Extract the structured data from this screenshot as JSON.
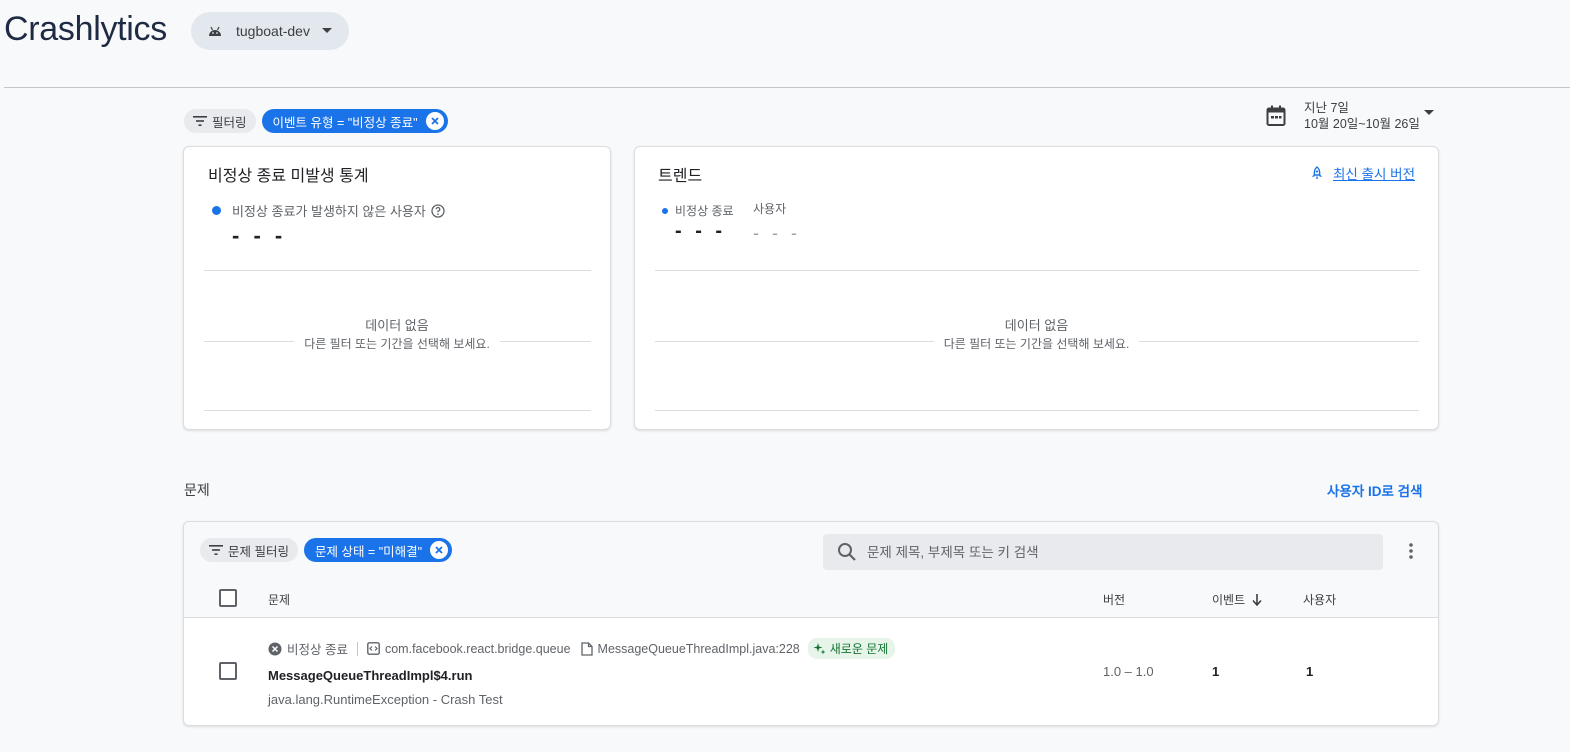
{
  "header": {
    "title": "Crashlytics",
    "project": "tugboat-dev"
  },
  "filters": {
    "filter_label": "필터링",
    "active_filter": "이벤트 유형 = \"비정상 종료\""
  },
  "date_range": {
    "line1": "지난 7일",
    "line2": "10월 20일~10월 26일"
  },
  "crash_free_card": {
    "title": "비정상 종료 미발생 통계",
    "legend": "비정상 종료가 발생하지 않은 사용자",
    "value": "- - -",
    "no_data_title": "데이터 없음",
    "no_data_sub": "다른 필터 또는 기간을 선택해 보세요."
  },
  "trends_card": {
    "title": "트렌드",
    "latest_release_link": "최신 출시 버전",
    "legend_crashes": "비정상 종료",
    "legend_users": "사용자",
    "crashes_value": "- - -",
    "users_value": "- - -",
    "no_data_title": "데이터 없음",
    "no_data_sub": "다른 필터 또는 기간을 선택해 보세요."
  },
  "issues": {
    "section_label": "문제",
    "search_by_user_link": "사용자 ID로 검색",
    "filter_label": "문제 필터링",
    "active_filter": "문제 상태 = \"미해결\"",
    "search_placeholder": "문제 제목, 부제목 또는 키 검색",
    "columns": {
      "issue": "문제",
      "version": "버전",
      "events": "이벤트",
      "users": "사용자"
    },
    "rows": [
      {
        "type": "비정상 종료",
        "package": "com.facebook.react.bridge.queue",
        "file": "MessageQueueThreadImpl.java:228",
        "badge": "새로운 문제",
        "title": "MessageQueueThreadImpl$4.run",
        "subtitle": "java.lang.RuntimeException - Crash Test",
        "version": "1.0 – 1.0",
        "events": "1",
        "users": "1"
      }
    ]
  },
  "colors": {
    "accent": "#1a73e8",
    "new_badge_bg": "#e6f4ea",
    "new_badge_text": "#137333"
  }
}
